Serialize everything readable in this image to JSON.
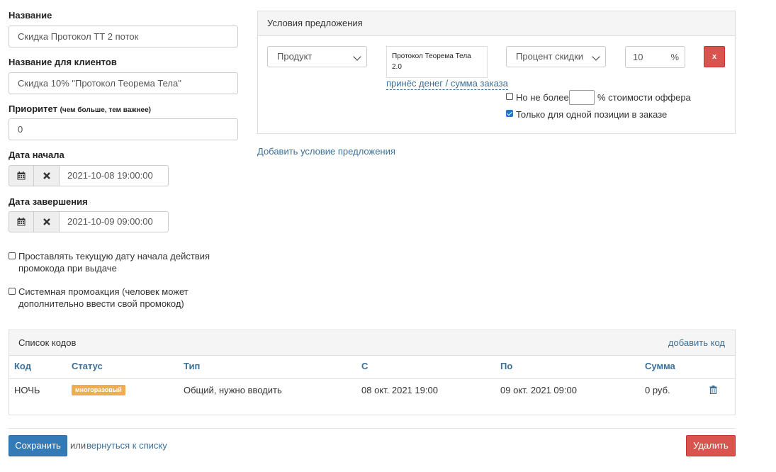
{
  "form": {
    "name_label": "Название",
    "name_value": "Скидка Протокол ТТ 2 поток",
    "client_name_label": "Название для клиентов",
    "client_name_value": "Скидка 10% \"Протокол Теорема Тела\"",
    "priority_label": "Приоритет",
    "priority_hint": "(чем больше, тем важнее)",
    "priority_value": "0",
    "start_label": "Дата начала",
    "start_value": "2021-10-08 19:00:00",
    "end_label": "Дата завершения",
    "end_value": "2021-10-09 09:00:00",
    "checkbox_current_date": "Проставлять текущую дату начала действия промокода при выдаче",
    "checkbox_system": "Системная промоакция (человек может дополнительно ввести свой промокод)"
  },
  "conditions": {
    "title": "Условия предложения",
    "type_select": "Продукт",
    "product_value": "Протокол Теорема Тела 2.0",
    "product_link": "принёс денег / сумма заказа",
    "discount_select": "Процент скидки",
    "percent_value": "10",
    "percent_unit": "%",
    "remove_label": "x",
    "max_prefix": "Но не более",
    "max_value": "",
    "max_suffix": "% стоимости оффера",
    "single_position": "Только для одной позиции в заказе",
    "add_condition": "Добавить условие предложения"
  },
  "codes": {
    "title": "Список кодов",
    "add_code": "добавить код",
    "headers": [
      "Код",
      "Статус",
      "Тип",
      "С",
      "По",
      "Сумма"
    ],
    "rows": [
      {
        "code": "НОЧЬ",
        "status": "многоразовый",
        "type": "Общий, нужно вводить",
        "from": "08 окт. 2021 19:00",
        "to": "09 окт. 2021 09:00",
        "sum": "0 руб."
      }
    ]
  },
  "footer": {
    "save": "Сохранить",
    "or": "или",
    "back_link": "вернуться к списку",
    "delete": "Удалить"
  },
  "colors": {
    "accent": "#337ab7",
    "danger": "#d9534f",
    "badge": "#f0ad4e",
    "link": "#3a6f9a"
  }
}
